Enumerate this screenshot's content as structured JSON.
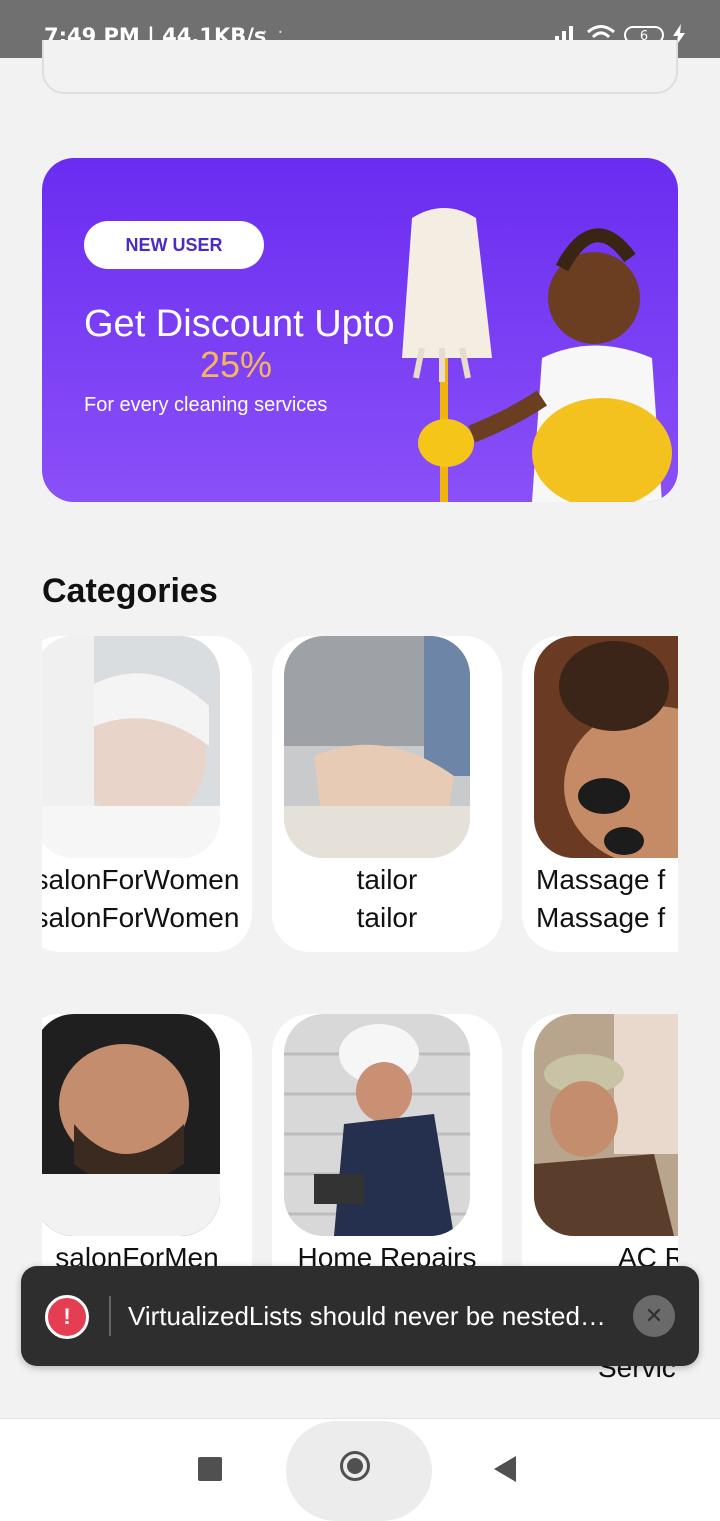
{
  "status_bar": {
    "time": "7:49 PM",
    "speed": "| 44.1KB/s",
    "dots": "· ·",
    "battery": "6"
  },
  "banner": {
    "badge": "NEW USER",
    "title": "Get Discount Upto",
    "percent": "25%",
    "subtitle": "For every cleaning services",
    "colors": {
      "gradient_top": "#6a2cf0",
      "gradient_bottom": "#8a50f8",
      "percent": "#f6b65b"
    }
  },
  "categories_title": "Categories",
  "categories": [
    {
      "name": "salonForWomen",
      "subtitle": "salonForWomen"
    },
    {
      "name": "tailor",
      "subtitle": "tailor"
    },
    {
      "name": "Massage f",
      "subtitle": "Massage f"
    },
    {
      "name": "salonForMen"
    },
    {
      "name": "Home Repairs"
    },
    {
      "name": "AC Rep"
    }
  ],
  "partial_label": "Servic",
  "toast": {
    "message": "VirtualizedLists should never be nested i..."
  }
}
